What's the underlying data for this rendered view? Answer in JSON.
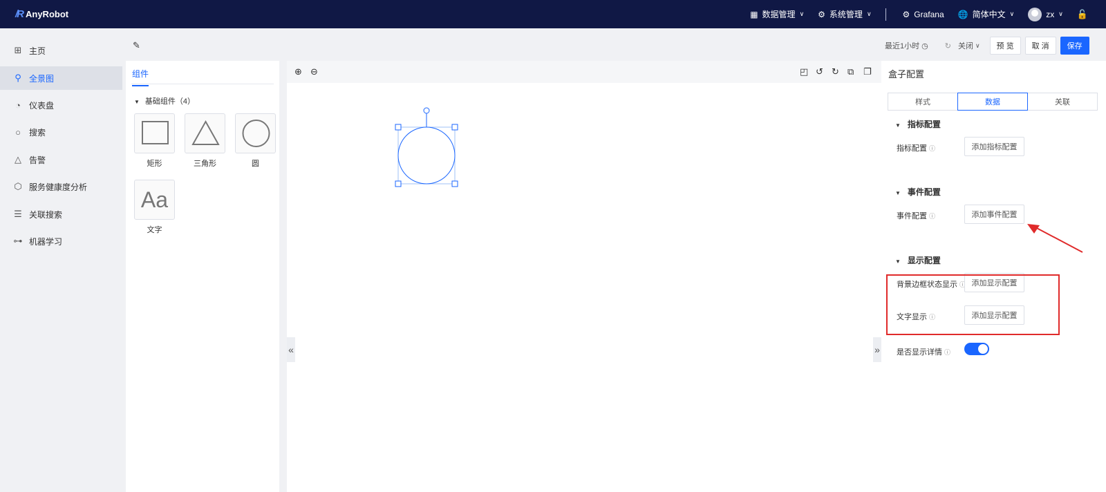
{
  "app": {
    "name": "AnyRobot",
    "logo_mark": "/R"
  },
  "topbar": {
    "data_mgmt": "数据管理",
    "sys_mgmt": "系统管理",
    "grafana": "Grafana",
    "language": "简体中文",
    "user": "zx"
  },
  "sidebar": {
    "items": [
      {
        "label": "主页",
        "icon": "grid-icon"
      },
      {
        "label": "全景图",
        "icon": "topology-icon"
      },
      {
        "label": "仪表盘",
        "icon": "pie-icon"
      },
      {
        "label": "搜索",
        "icon": "search-icon"
      },
      {
        "label": "告警",
        "icon": "warning-icon"
      },
      {
        "label": "服务健康度分析",
        "icon": "cube-icon"
      },
      {
        "label": "关联搜索",
        "icon": "list-search-icon"
      },
      {
        "label": "机器学习",
        "icon": "nodes-icon"
      }
    ],
    "active_index": 1
  },
  "header": {
    "time_range": "最近1小时",
    "refresh": "关闭",
    "preview": "预 览",
    "cancel": "取 消",
    "save": "保存"
  },
  "components": {
    "tab": "组件",
    "group": "基础组件（4）",
    "items": [
      {
        "label": "矩形"
      },
      {
        "label": "三角形"
      },
      {
        "label": "圆"
      },
      {
        "label": "文字",
        "glyph": "Aa"
      }
    ]
  },
  "config": {
    "title": "盒子配置",
    "tabs": [
      "样式",
      "数据",
      "关联"
    ],
    "active_tab": 1,
    "sections": {
      "metric": {
        "title": "指标配置",
        "label": "指标配置",
        "button": "添加指标配置"
      },
      "event": {
        "title": "事件配置",
        "label": "事件配置",
        "button": "添加事件配置"
      },
      "display": {
        "title": "显示配置",
        "bg_label": "背景边框状态显示",
        "bg_button": "添加显示配置",
        "text_label": "文字显示",
        "text_button": "添加显示配置"
      },
      "detail": {
        "label": "是否显示详情",
        "enabled": true
      }
    }
  },
  "colors": {
    "topbar": "#101845",
    "accent": "#1a66ff",
    "annotation": "#e02a2a"
  }
}
